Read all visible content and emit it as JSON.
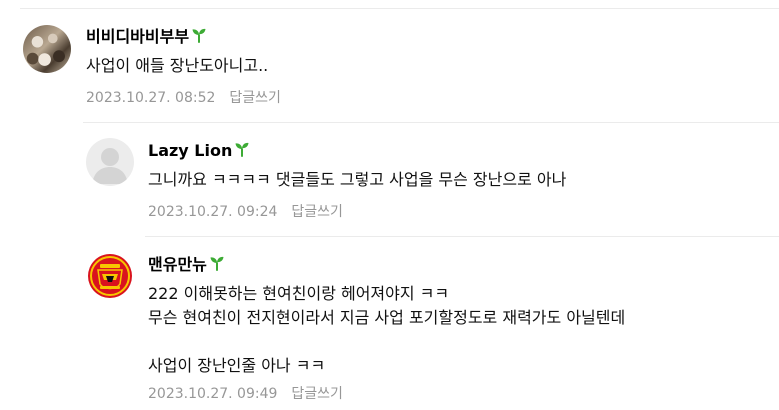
{
  "comments": [
    {
      "nickname": "비비디바비부부",
      "text_lines": [
        "사업이 애들 장난도아니고.."
      ],
      "date": "2023.10.27. 08:52",
      "reply_label": "답글쓰기"
    },
    {
      "nickname": "Lazy Lion",
      "text_lines": [
        "그니까요 ㅋㅋㅋㅋ 댓글들도 그렇고 사업을 무슨 장난으로 아나"
      ],
      "date": "2023.10.27. 09:24",
      "reply_label": "답글쓰기"
    },
    {
      "nickname": "맨유만뉴",
      "text_lines": [
        "222 이해못하는 현여친이랑 헤어져야지 ㅋㅋ",
        "무슨 현여친이 전지현이라서 지금 사업 포기할정도로 재력가도 아닐텐데",
        "",
        "사업이 장난인줄 아나 ㅋㅋ"
      ],
      "date": "2023.10.27. 09:49",
      "reply_label": "답글쓰기"
    }
  ],
  "colors": {
    "sprout": "#3dab35",
    "meta": "#979797",
    "divider": "#ebebeb"
  },
  "icons": {
    "badge": "sprout-icon",
    "default_avatar": "person-silhouette-icon",
    "crest_avatar": "football-club-crest-icon"
  }
}
